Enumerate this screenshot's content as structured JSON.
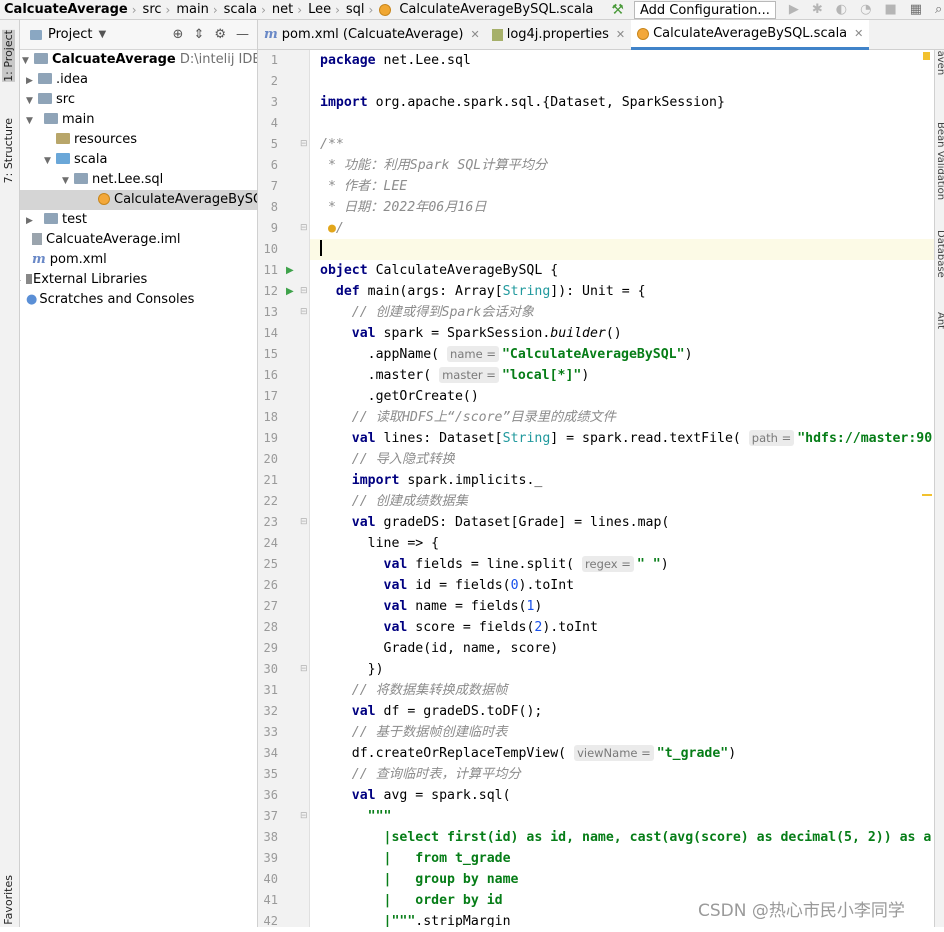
{
  "navbar": {
    "crumbs": [
      "CalcuateAverage",
      "src",
      "main",
      "scala",
      "net",
      "Lee",
      "sql",
      "CalculateAverageBySQL.scala"
    ],
    "add_config": "Add Configuration..."
  },
  "left_strip": {
    "project_tab": "1: Project",
    "structure_tab": "7: Structure",
    "favorites_tab": "Favorites"
  },
  "project_panel": {
    "title": "Project",
    "tree": [
      {
        "label": "CalcuateAverage",
        "path": "D:\\intelij IDEA\\Calcua",
        "icon": "folder-icon"
      },
      {
        "label": ".idea",
        "icon": "folder-icon"
      },
      {
        "label": "src",
        "icon": "folder-icon"
      },
      {
        "label": "main",
        "icon": "folder-icon"
      },
      {
        "label": "resources",
        "icon": "resources-folder-icon"
      },
      {
        "label": "scala",
        "icon": "source-folder-icon"
      },
      {
        "label": "net.Lee.sql",
        "icon": "package-icon"
      },
      {
        "label": "CalculateAverageBySQL",
        "icon": "scala-object-icon"
      },
      {
        "label": "test",
        "icon": "folder-icon"
      },
      {
        "label": "CalcuateAverage.iml",
        "icon": "iml-file-icon"
      },
      {
        "label": "pom.xml",
        "icon": "maven-icon"
      },
      {
        "label": "External Libraries",
        "icon": "library-icon"
      },
      {
        "label": "Scratches and Consoles",
        "icon": "scratch-icon"
      }
    ]
  },
  "tabs": [
    {
      "label": "pom.xml (CalcuateAverage)"
    },
    {
      "label": "log4j.properties"
    },
    {
      "label": "CalculateAverageBySQL.scala"
    }
  ],
  "right_strip": [
    "Maven",
    "Bean Validation",
    "Database",
    "Ant"
  ],
  "editor": {
    "line_numbers": [
      "1",
      "2",
      "3",
      "4",
      "5",
      "6",
      "7",
      "8",
      "9",
      "10",
      "11",
      "12",
      "13",
      "14",
      "15",
      "16",
      "17",
      "18",
      "19",
      "20",
      "21",
      "22",
      "23",
      "24",
      "25",
      "26",
      "27",
      "28",
      "29",
      "30",
      "31",
      "32",
      "33",
      "34",
      "35",
      "36",
      "37",
      "38",
      "39",
      "40",
      "41",
      "42"
    ],
    "lines": [
      [
        [
          "k",
          "package"
        ],
        [
          "p",
          " net.Lee.sql"
        ]
      ],
      [],
      [
        [
          "k",
          "import"
        ],
        [
          "p",
          " org.apache.spark.sql.{Dataset, SparkSession}"
        ]
      ],
      [],
      [
        [
          "c",
          "/**"
        ]
      ],
      [
        [
          "c",
          " * 功能：利用Spark SQL计算平均分"
        ]
      ],
      [
        [
          "c",
          " * 作者：LEE"
        ]
      ],
      [
        [
          "c",
          " * 日期：2022年06月16日"
        ]
      ],
      [
        [
          "bulb",
          " ●"
        ],
        [
          "c",
          "/"
        ]
      ],
      [
        [
          "caret",
          ""
        ]
      ],
      [
        [
          "k",
          "object"
        ],
        [
          "p",
          " CalculateAverageBySQL {"
        ]
      ],
      [
        [
          "p",
          "  "
        ],
        [
          "k",
          "def"
        ],
        [
          "p",
          " main(args: Array["
        ],
        [
          "t",
          "String"
        ],
        [
          "p",
          "]): Unit = {"
        ]
      ],
      [
        [
          "c",
          "    // 创建或得到Spark会话对象"
        ]
      ],
      [
        [
          "p",
          "    "
        ],
        [
          "k",
          "val"
        ],
        [
          "p",
          " spark = SparkSession."
        ],
        [
          "i",
          "builder"
        ],
        [
          "p",
          "()"
        ]
      ],
      [
        [
          "p",
          "      .appName( "
        ],
        [
          "h",
          "name ="
        ],
        [
          "s",
          "\"CalculateAverageBySQL\""
        ],
        [
          "p",
          ")"
        ]
      ],
      [
        [
          "p",
          "      .master( "
        ],
        [
          "h",
          "master ="
        ],
        [
          "s",
          "\"local[*]\""
        ],
        [
          "p",
          ")"
        ]
      ],
      [
        [
          "p",
          "      .getOrCreate()"
        ]
      ],
      [
        [
          "c",
          "    // 读取HDFS上“/score”目录里的成绩文件"
        ]
      ],
      [
        [
          "p",
          "    "
        ],
        [
          "k",
          "val"
        ],
        [
          "p",
          " lines: Dataset["
        ],
        [
          "t",
          "String"
        ],
        [
          "p",
          "] = spark.read.textFile( "
        ],
        [
          "h",
          "path ="
        ],
        [
          "s",
          "\"hdfs://master:90"
        ]
      ],
      [
        [
          "c",
          "    // 导入隐式转换"
        ]
      ],
      [
        [
          "p",
          "    "
        ],
        [
          "k",
          "import"
        ],
        [
          "p",
          " spark.implicits._"
        ]
      ],
      [
        [
          "c",
          "    // 创建成绩数据集"
        ]
      ],
      [
        [
          "p",
          "    "
        ],
        [
          "k",
          "val"
        ],
        [
          "p",
          " gradeDS: Dataset[Grade] = lines.map("
        ]
      ],
      [
        [
          "p",
          "      line => {"
        ]
      ],
      [
        [
          "p",
          "        "
        ],
        [
          "k",
          "val"
        ],
        [
          "p",
          " fields = line.split( "
        ],
        [
          "h",
          "regex ="
        ],
        [
          "s",
          "\" \""
        ],
        [
          "p",
          ")"
        ]
      ],
      [
        [
          "p",
          "        "
        ],
        [
          "k",
          "val"
        ],
        [
          "p",
          " id = fields("
        ],
        [
          "n",
          "0"
        ],
        [
          "p",
          ").toInt"
        ]
      ],
      [
        [
          "p",
          "        "
        ],
        [
          "k",
          "val"
        ],
        [
          "p",
          " name = fields("
        ],
        [
          "n",
          "1"
        ],
        [
          "p",
          ")"
        ]
      ],
      [
        [
          "p",
          "        "
        ],
        [
          "k",
          "val"
        ],
        [
          "p",
          " score = fields("
        ],
        [
          "n",
          "2"
        ],
        [
          "p",
          ").toInt"
        ]
      ],
      [
        [
          "p",
          "        Grade(id, name, score)"
        ]
      ],
      [
        [
          "p",
          "      })"
        ]
      ],
      [
        [
          "c",
          "    // 将数据集转换成数据帧"
        ]
      ],
      [
        [
          "p",
          "    "
        ],
        [
          "k",
          "val"
        ],
        [
          "p",
          " df = gradeDS.toDF();"
        ]
      ],
      [
        [
          "c",
          "    // 基于数据帧创建临时表"
        ]
      ],
      [
        [
          "p",
          "    df.createOrReplaceTempView( "
        ],
        [
          "h",
          "viewName ="
        ],
        [
          "s",
          "\"t_grade\""
        ],
        [
          "p",
          ")"
        ]
      ],
      [
        [
          "c",
          "    // 查询临时表，计算平均分"
        ]
      ],
      [
        [
          "p",
          "    "
        ],
        [
          "k",
          "val"
        ],
        [
          "p",
          " avg = spark.sql("
        ]
      ],
      [
        [
          "s",
          "      \"\"\""
        ]
      ],
      [
        [
          "s",
          "        |select first(id) as id, name, cast(avg(score) as decimal(5, 2)) as a"
        ]
      ],
      [
        [
          "s",
          "        |   from t_grade"
        ]
      ],
      [
        [
          "s",
          "        |   group by name"
        ]
      ],
      [
        [
          "s",
          "        |   order by id"
        ]
      ],
      [
        [
          "s",
          "        |\"\"\""
        ],
        [
          "p",
          ".stripMargin"
        ]
      ]
    ]
  },
  "watermark": "CSDN @热心市民小李同学"
}
